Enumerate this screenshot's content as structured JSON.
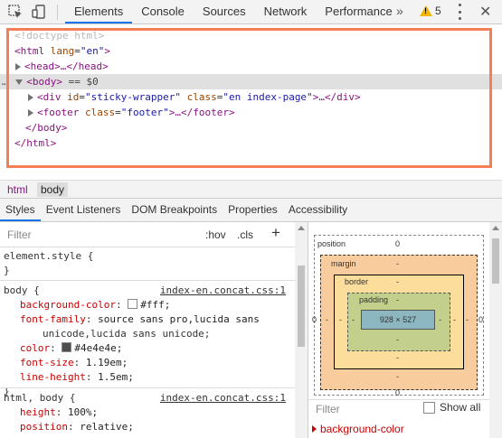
{
  "toolbar": {
    "tabs": [
      "Elements",
      "Console",
      "Sources",
      "Network",
      "Performance"
    ],
    "more": "»",
    "warning_count": "5",
    "close": "✕"
  },
  "dom": {
    "doctype": "<!doctype html>",
    "html_open_tag": "html",
    "html_attr": "lang",
    "html_val": "\"en\"",
    "head_tag": "head",
    "head_collapsed": "…</head>",
    "body_tag": "body",
    "body_eq": "== $0",
    "div_tag": "div",
    "div_attr1": "id",
    "div_val1": "\"sticky-wrapper\"",
    "div_attr2": "class",
    "div_val2": "\"en index-page\"",
    "div_collapsed": "…</div>",
    "footer_tag": "footer",
    "footer_attr": "class",
    "footer_val": "\"footer\"",
    "footer_collapsed": "…</footer>",
    "body_close": "</body>",
    "html_close": "</html>",
    "gutter_dots": "…"
  },
  "breadcrumb": [
    "html",
    "body"
  ],
  "subtabs": [
    "Styles",
    "Event Listeners",
    "DOM Breakpoints",
    "Properties",
    "Accessibility"
  ],
  "styles": {
    "filter_placeholder": "Filter",
    "hov": ":hov",
    "cls": ".cls",
    "plus": "+",
    "element_style": "element.style {",
    "close_brace": "}",
    "rule1_selector": "body {",
    "rule1_source": "index-en.concat.css:1",
    "rule1_props": [
      {
        "name": "background-color",
        "value": "#fff;",
        "swatch": "#ffffff"
      },
      {
        "name": "font-family",
        "value": "source sans pro,lucida sans",
        "cont": "unicode,lucida sans unicode;"
      },
      {
        "name": "color",
        "value": "#4e4e4e;",
        "swatch": "#4e4e4e"
      },
      {
        "name": "font-size",
        "value": "1.19em;"
      },
      {
        "name": "line-height",
        "value": "1.5em;"
      }
    ],
    "rule2_selector": "html, body {",
    "rule2_source": "index-en.concat.css:1",
    "rule2_props": [
      {
        "name": "height",
        "value": "100%;"
      },
      {
        "name": "position",
        "value": "relative;"
      }
    ]
  },
  "computed": {
    "position_label": "position",
    "position_val": "0",
    "margin_label": "margin",
    "border_label": "border",
    "padding_label": "padding",
    "dash": "-",
    "zero": "0",
    "content_size": "928 × 527",
    "filter_placeholder": "Filter",
    "show_all": "Show all",
    "first_prop": "background-color"
  },
  "colors": {
    "highlight_border": "#f47f55",
    "tab_accent": "#1a73e8",
    "tag": "#881280",
    "attr": "#994500",
    "value": "#1a1aa6",
    "prop_name": "#c80000",
    "margin_box": "#f9cc9d",
    "border_box": "#fddd9b",
    "padding_box": "#c3d08b",
    "content_box": "#8cb6c0"
  }
}
